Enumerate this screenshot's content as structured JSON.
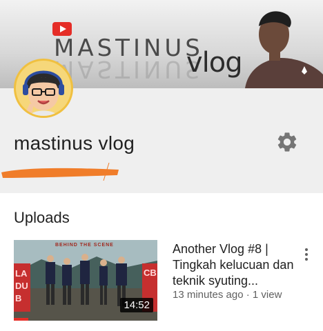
{
  "banner": {
    "brand_text": "MASTINUS",
    "brand_reflection": "MASTINUS",
    "vlog_text": "vlog",
    "logo_icon": "youtube-play-icon"
  },
  "channel": {
    "name": "mastinus vlog",
    "avatar_icon": "cartoon-avatar",
    "settings_icon": "gear-icon"
  },
  "uploads": {
    "title": "Uploads",
    "videos": [
      {
        "title": "Another Vlog #8 | Tingkah kelucuan dan teknik syuting...",
        "duration": "14:52",
        "meta": "13 minutes ago · 1 view",
        "watched_fraction": 0.1,
        "thumb_caption": "BEHIND THE SCENE",
        "thumb_left_text": "LA DUB",
        "thumb_right_text": "CB"
      }
    ]
  },
  "colors": {
    "accent": "#e52d27",
    "orange_mark": "#f07d2a",
    "background": "#efefef"
  }
}
